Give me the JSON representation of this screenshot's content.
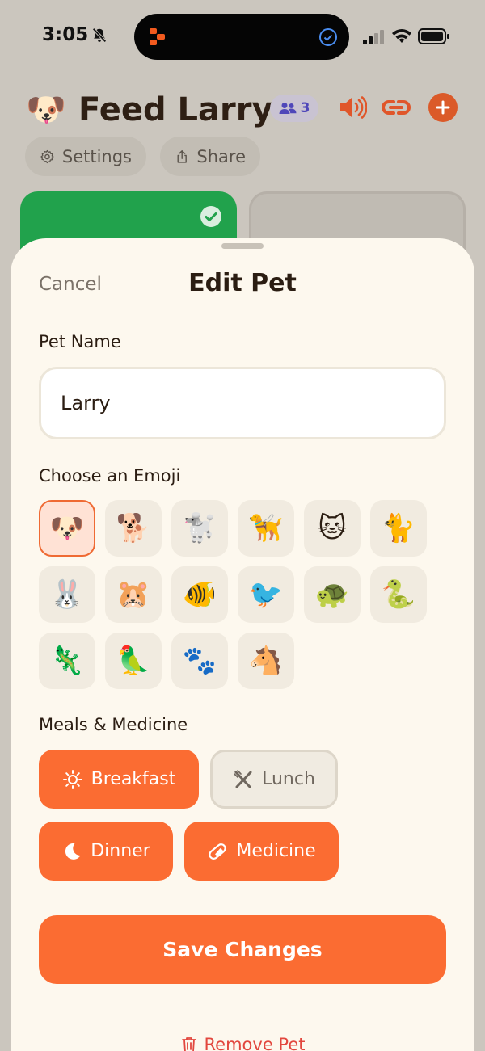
{
  "status_bar": {
    "time": "3:05"
  },
  "app": {
    "pet_emoji": "🐶",
    "title": "Feed Larry",
    "members_count": "3",
    "settings_label": "Settings",
    "share_label": "Share"
  },
  "sheet": {
    "cancel_label": "Cancel",
    "title": "Edit Pet",
    "pet_name_label": "Pet Name",
    "pet_name_value": "Larry",
    "emoji_label": "Choose an Emoji",
    "emojis": [
      "🐶",
      "🐕",
      "🐩",
      "🦮",
      "🐱",
      "🐈",
      "🐰",
      "🐹",
      "🐠",
      "🐦",
      "🐢",
      "🐍",
      "🦎",
      "🦜",
      "🐾",
      "🐴"
    ],
    "selected_emoji_index": 0,
    "meals_label": "Meals & Medicine",
    "meals": [
      {
        "label": "Breakfast",
        "icon": "sun-icon",
        "selected": true
      },
      {
        "label": "Lunch",
        "icon": "fork-knife-icon",
        "selected": false
      },
      {
        "label": "Dinner",
        "icon": "moon-icon",
        "selected": true
      },
      {
        "label": "Medicine",
        "icon": "pill-icon",
        "selected": true
      }
    ],
    "save_label": "Save Changes",
    "remove_label": "Remove Pet"
  },
  "colors": {
    "accent": "#fb6c32",
    "green_card": "#21a24c",
    "sheet_bg": "#fdf8ee",
    "danger": "#e2473e"
  }
}
